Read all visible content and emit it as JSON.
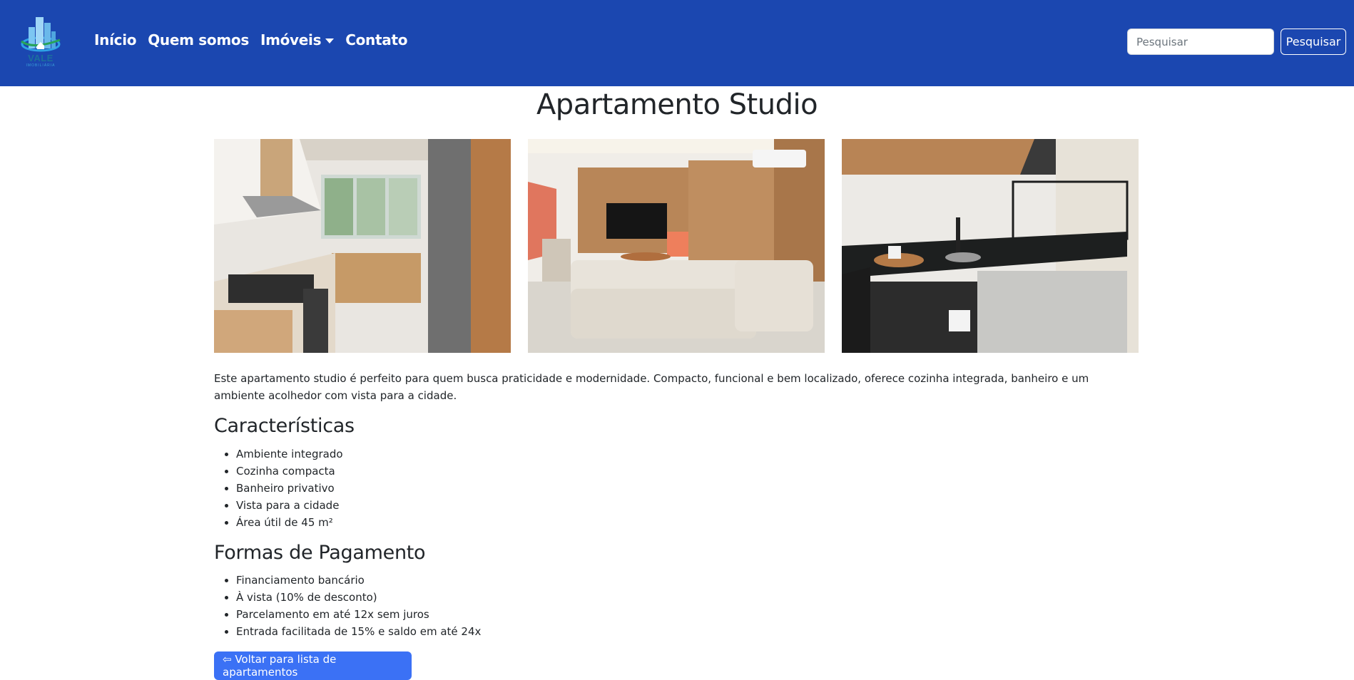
{
  "navbar": {
    "logo_text": "VALE",
    "logo_sub": "IMOBILIÁRIA",
    "links": [
      {
        "label": "Início"
      },
      {
        "label": "Quem somos"
      },
      {
        "label": "Imóveis"
      },
      {
        "label": "Contato"
      }
    ],
    "search_placeholder": "Pesquisar",
    "search_button": "Pesquisar",
    "bg_color": "#1b47b0"
  },
  "main": {
    "title": "Apartamento Studio",
    "photos": [
      {
        "icon": "kitchen-photo"
      },
      {
        "icon": "living-room-photo"
      },
      {
        "icon": "kitchenette-photo"
      }
    ],
    "description": "Este apartamento studio é perfeito para quem busca praticidade e modernidade. Compacto, funcional e bem localizado, oferece cozinha integrada, banheiro e um ambiente acolhedor com vista para a cidade.",
    "features_title": "Características",
    "features": [
      "Ambiente integrado",
      "Cozinha compacta",
      "Banheiro privativo",
      "Vista para a cidade",
      "Área útil de 45 m²"
    ],
    "payment_title": "Formas de Pagamento",
    "payments": [
      "Financiamento bancário",
      "À vista (10% de desconto)",
      "Parcelamento em até 12x sem juros",
      "Entrada facilitada de 15% e saldo em até 24x"
    ],
    "back_button": "⇦ Voltar para lista de apartamentos",
    "accent_color": "#3b71f5"
  }
}
